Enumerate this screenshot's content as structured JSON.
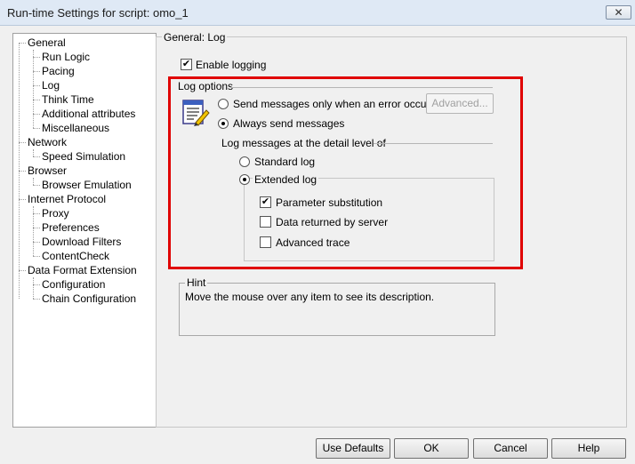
{
  "window": {
    "title": "Run-time Settings for script: omo_1",
    "close_label": "✕"
  },
  "tree": {
    "items": [
      {
        "label": "General",
        "level": 0
      },
      {
        "label": "Run Logic",
        "level": 1
      },
      {
        "label": "Pacing",
        "level": 1
      },
      {
        "label": "Log",
        "level": 1
      },
      {
        "label": "Think Time",
        "level": 1
      },
      {
        "label": "Additional attributes",
        "level": 1
      },
      {
        "label": "Miscellaneous",
        "level": 1
      },
      {
        "label": "Network",
        "level": 0
      },
      {
        "label": "Speed Simulation",
        "level": 1
      },
      {
        "label": "Browser",
        "level": 0
      },
      {
        "label": "Browser Emulation",
        "level": 1
      },
      {
        "label": "Internet Protocol",
        "level": 0
      },
      {
        "label": "Proxy",
        "level": 1
      },
      {
        "label": "Preferences",
        "level": 1
      },
      {
        "label": "Download Filters",
        "level": 1
      },
      {
        "label": "ContentCheck",
        "level": 1
      },
      {
        "label": "Data Format Extension",
        "level": 0
      },
      {
        "label": "Configuration",
        "level": 1
      },
      {
        "label": "Chain Configuration",
        "level": 1
      }
    ]
  },
  "panel": {
    "group_title": "General: Log",
    "enable_logging": {
      "label": "Enable logging",
      "checked": true,
      "mark": "✔"
    },
    "log_options": {
      "title": "Log options",
      "icon": "log-document-pen-icon",
      "radio_error_only": "Send messages only when an error occurs",
      "radio_always": "Always send messages",
      "advanced_button": "Advanced...",
      "detail_level_label": "Log messages at the detail level of",
      "standard_log": "Standard log",
      "extended_log": "Extended log",
      "parameter_substitution": "Parameter substitution",
      "data_returned": "Data returned by server",
      "advanced_trace": "Advanced trace",
      "param_mark": "✔"
    },
    "hint": {
      "title": "Hint",
      "text": "Move the mouse over any item to see its description."
    }
  },
  "footer": {
    "use_defaults": "Use Defaults",
    "ok": "OK",
    "cancel": "Cancel",
    "help": "Help"
  },
  "colors": {
    "highlight": "#e00000",
    "titlebar": "#dfe9f5",
    "window": "#f0f0f0"
  }
}
